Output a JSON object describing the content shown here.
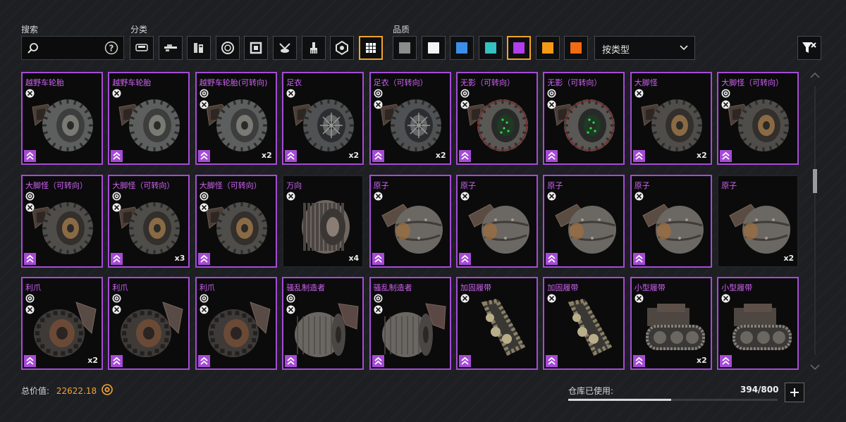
{
  "search": {
    "label": "搜索",
    "value": "",
    "placeholder": "",
    "help_icon": "help-icon"
  },
  "category": {
    "label": "分类",
    "buttons": [
      {
        "icon": "cabin-icon",
        "selected": false
      },
      {
        "icon": "weapon-icon",
        "selected": false
      },
      {
        "icon": "module-icon",
        "selected": false
      },
      {
        "icon": "wheel-icon",
        "selected": false
      },
      {
        "icon": "frame-icon",
        "selected": false
      },
      {
        "icon": "decor-icon",
        "selected": false
      },
      {
        "icon": "paint-brush-icon",
        "selected": false
      },
      {
        "icon": "sticker-icon",
        "selected": false
      },
      {
        "icon": "grid-all-icon",
        "selected": true
      }
    ]
  },
  "quality": {
    "label": "品质",
    "swatches": [
      {
        "color": "#8c8c8c",
        "selected": false
      },
      {
        "color": "#f4f4f4",
        "selected": false
      },
      {
        "color": "#3b8fe8",
        "selected": false
      },
      {
        "color": "#33c1c1",
        "selected": false
      },
      {
        "color": "#b13ded",
        "selected": true
      },
      {
        "color": "#f49a16",
        "selected": false
      },
      {
        "color": "#f26a12",
        "selected": false
      }
    ]
  },
  "sort": {
    "value": "按类型"
  },
  "colors": {
    "accent": "#f2a22a",
    "epic": "#a64bd6",
    "value": "#f3a33a"
  },
  "items": [
    {
      "name": "越野车轮胎",
      "art": "tire",
      "badges": [
        "wrench-icon"
      ],
      "qty": "",
      "rank": true
    },
    {
      "name": "越野车轮胎",
      "art": "tire",
      "badges": [
        "wrench-icon"
      ],
      "qty": "",
      "rank": true
    },
    {
      "name": "越野车轮胎(可转向)",
      "art": "tire",
      "badges": [
        "steer-icon",
        "wrench-icon"
      ],
      "qty": "x2",
      "rank": true
    },
    {
      "name": "足衣",
      "art": "sport",
      "badges": [
        "wrench-icon"
      ],
      "qty": "x2",
      "rank": true
    },
    {
      "name": "足衣（可转向）",
      "art": "sport",
      "badges": [
        "steer-icon",
        "wrench-icon"
      ],
      "qty": "x2",
      "rank": true
    },
    {
      "name": "无影（可转向）",
      "art": "glow",
      "badges": [
        "steer-icon",
        "wrench-icon"
      ],
      "qty": "",
      "rank": true
    },
    {
      "name": "无影（可转向）",
      "art": "glow",
      "badges": [
        "steer-icon",
        "wrench-icon"
      ],
      "qty": "",
      "rank": true
    },
    {
      "name": "大脚怪",
      "art": "big",
      "badges": [
        "wrench-icon"
      ],
      "qty": "x2",
      "rank": true
    },
    {
      "name": "大脚怪（可转向）",
      "art": "big",
      "badges": [
        "steer-icon",
        "wrench-icon"
      ],
      "qty": "",
      "rank": true
    },
    {
      "name": "大脚怪（可转向）",
      "art": "big",
      "badges": [
        "steer-icon",
        "wrench-icon"
      ],
      "qty": "",
      "rank": true
    },
    {
      "name": "大脚怪（可转向）",
      "art": "big",
      "badges": [
        "steer-icon",
        "wrench-icon"
      ],
      "qty": "x3",
      "rank": true
    },
    {
      "name": "大脚怪（可转向）",
      "art": "big",
      "badges": [
        "steer-icon",
        "wrench-icon"
      ],
      "qty": "",
      "rank": true
    },
    {
      "name": "万向",
      "art": "omni",
      "badges": [
        "wrench-icon"
      ],
      "qty": "x4",
      "rank": false
    },
    {
      "name": "原子",
      "art": "sphere",
      "badges": [
        "wrench-icon"
      ],
      "qty": "",
      "rank": true
    },
    {
      "name": "原子",
      "art": "sphere",
      "badges": [
        "wrench-icon"
      ],
      "qty": "",
      "rank": true
    },
    {
      "name": "原子",
      "art": "sphere",
      "badges": [
        "wrench-icon"
      ],
      "qty": "",
      "rank": true
    },
    {
      "name": "原子",
      "art": "sphere",
      "badges": [
        "wrench-icon"
      ],
      "qty": "",
      "rank": true
    },
    {
      "name": "原子",
      "art": "sphere",
      "badges": [],
      "qty": "x2",
      "rank": false
    },
    {
      "name": "利爪",
      "art": "claw",
      "badges": [
        "steer-icon",
        "wrench-icon"
      ],
      "qty": "x2",
      "rank": true
    },
    {
      "name": "利爪",
      "art": "claw",
      "badges": [
        "steer-icon",
        "wrench-icon"
      ],
      "qty": "",
      "rank": true
    },
    {
      "name": "利爪",
      "art": "claw",
      "badges": [
        "steer-icon",
        "wrench-icon"
      ],
      "qty": "",
      "rank": true
    },
    {
      "name": "骚乱制造者",
      "art": "riot",
      "badges": [
        "steer-icon",
        "wrench-icon"
      ],
      "qty": "",
      "rank": true
    },
    {
      "name": "骚乱制造者",
      "art": "riot",
      "badges": [
        "steer-icon",
        "wrench-icon"
      ],
      "qty": "",
      "rank": true
    },
    {
      "name": "加固履带",
      "art": "track",
      "badges": [
        "wrench-icon"
      ],
      "qty": "",
      "rank": true
    },
    {
      "name": "加固履带",
      "art": "track",
      "badges": [
        "wrench-icon"
      ],
      "qty": "",
      "rank": true
    },
    {
      "name": "小型履带",
      "art": "smalltrack",
      "badges": [
        "wrench-icon"
      ],
      "qty": "x2",
      "rank": true
    },
    {
      "name": "小型履带",
      "art": "smalltrack",
      "badges": [
        "wrench-icon"
      ],
      "qty": "",
      "rank": true
    }
  ],
  "footer": {
    "total_label": "总价值:",
    "total_value": "22622.18",
    "coin_icon": "coin-icon",
    "storage_label": "仓库已使用:",
    "storage_value": "394/800",
    "storage_fraction": 0.4925
  }
}
